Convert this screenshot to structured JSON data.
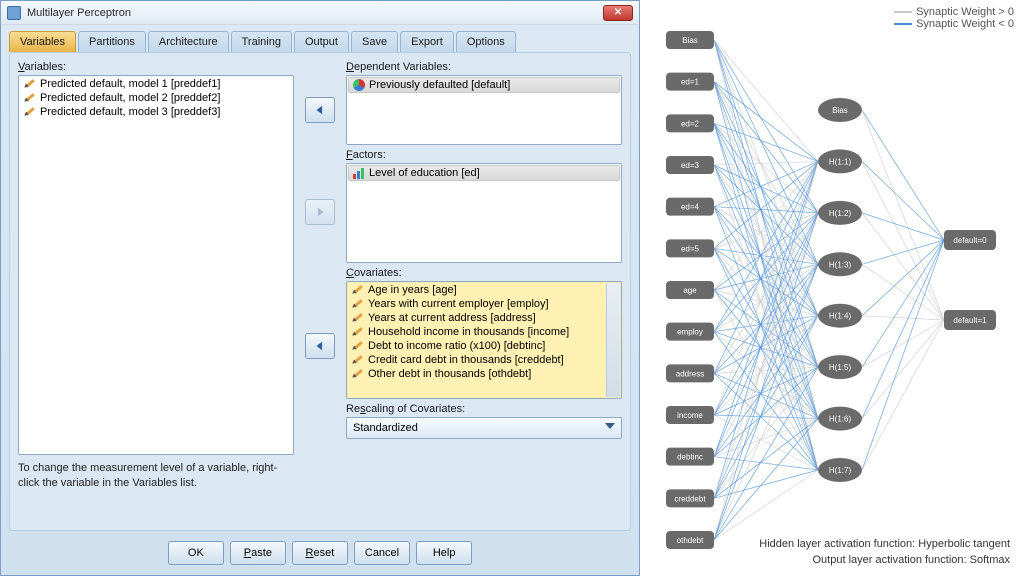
{
  "dialog": {
    "title": "Multilayer Perceptron",
    "tabs": [
      "Variables",
      "Partitions",
      "Architecture",
      "Training",
      "Output",
      "Save",
      "Export",
      "Options"
    ],
    "active_tab": 0,
    "variables_label": "Variables:",
    "variables": [
      "Predicted default, model 1 [preddef1]",
      "Predicted default, model 2 [preddef2]",
      "Predicted default, model 3 [preddef3]"
    ],
    "hint": "To change the measurement level of a variable, right-click the variable in the Variables list.",
    "dv_label": "Dependent Variables:",
    "dv": [
      "Previously defaulted [default]"
    ],
    "factors_label": "Factors:",
    "factors": [
      "Level of education [ed]"
    ],
    "cov_label": "Covariates:",
    "covariates": [
      "Age in years [age]",
      "Years with current employer [employ]",
      "Years at current address [address]",
      "Household income in thousands [income]",
      "Debt to income ratio (x100) [debtinc]",
      "Credit card debt in thousands [creddebt]",
      "Other debt in thousands [othdebt]"
    ],
    "rescale_label": "Rescaling of Covariates:",
    "rescale_value": "Standardized",
    "buttons": [
      "OK",
      "Paste",
      "Reset",
      "Cancel",
      "Help"
    ]
  },
  "network": {
    "legend_pos": "Synaptic Weight > 0",
    "legend_neg": "Synaptic Weight < 0",
    "inputs": [
      "Bias",
      "ed=1",
      "ed=2",
      "ed=3",
      "ed=4",
      "ed=5",
      "age",
      "employ",
      "address",
      "income",
      "debtinc",
      "creddebt",
      "othdebt"
    ],
    "hidden": [
      "Bias",
      "H(1:1)",
      "H(1:2)",
      "H(1:3)",
      "H(1:4)",
      "H(1:5)",
      "H(1:6)",
      "H(1:7)"
    ],
    "outputs": [
      "default=0",
      "default=1"
    ],
    "caption1": "Hidden layer activation function: Hyperbolic tangent",
    "caption2": "Output layer activation function: Softmax",
    "color_pos": "#c9c9c9",
    "color_neg": "#4a8fd6"
  }
}
